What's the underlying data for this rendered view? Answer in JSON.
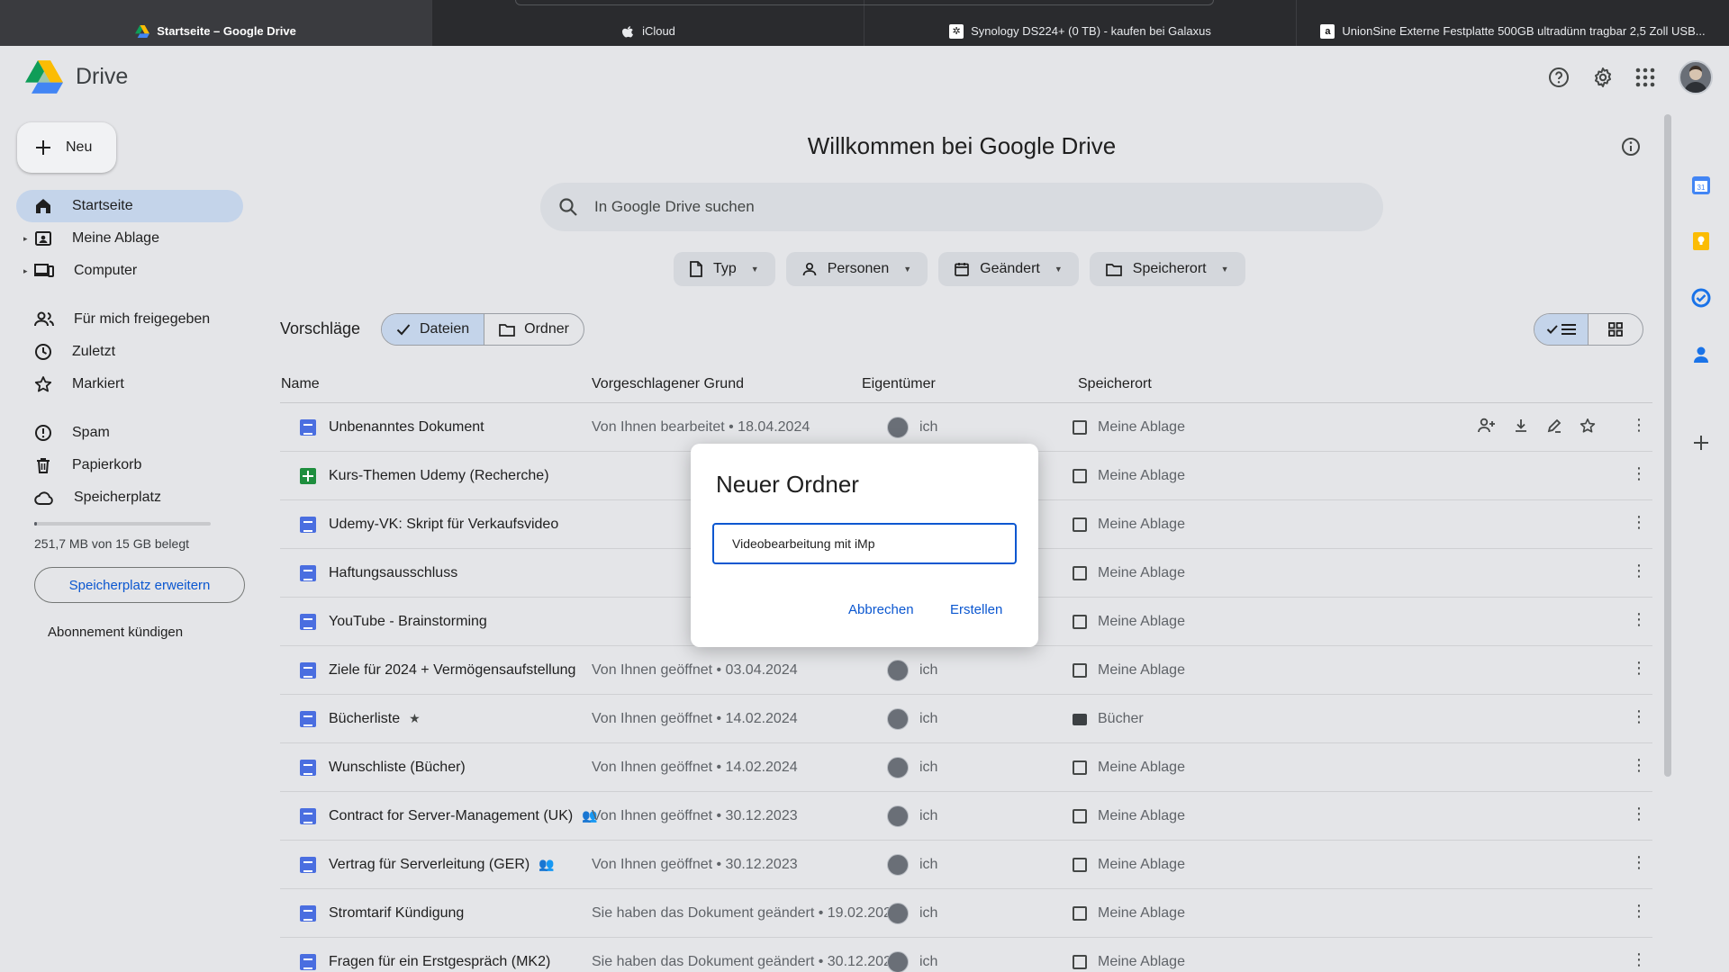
{
  "browser": {
    "tabs": [
      {
        "title": "Startseite – Google Drive",
        "active": true,
        "icon": "drive-icon"
      },
      {
        "title": "iCloud",
        "active": false,
        "icon": "apple-icon"
      },
      {
        "title": "Synology DS224+ (0 TB) - kaufen bei Galaxus",
        "active": false,
        "icon": "galaxus-icon"
      },
      {
        "title": "UnionSine Externe Festplatte 500GB ultradünn tragbar 2,5 Zoll USB...",
        "active": false,
        "icon": "amazon-icon"
      }
    ]
  },
  "app": {
    "name": "Drive"
  },
  "sidebar": {
    "new_label": "Neu",
    "items": [
      {
        "label": "Startseite",
        "icon": "home-icon",
        "active": true
      },
      {
        "label": "Meine Ablage",
        "icon": "drive-folder-icon",
        "active": false
      },
      {
        "label": "Computer",
        "icon": "computer-icon",
        "active": false
      },
      {
        "label": "Für mich freigegeben",
        "icon": "people-icon",
        "active": false
      },
      {
        "label": "Zuletzt",
        "icon": "clock-icon",
        "active": false
      },
      {
        "label": "Markiert",
        "icon": "star-icon",
        "active": false
      },
      {
        "label": "Spam",
        "icon": "spam-icon",
        "active": false
      },
      {
        "label": "Papierkorb",
        "icon": "trash-icon",
        "active": false
      },
      {
        "label": "Speicherplatz",
        "icon": "cloud-icon",
        "active": false
      }
    ],
    "storage_text": "251,7 MB von 15 GB belegt",
    "storage_fraction": 0.017,
    "storage_button": "Speicherplatz erweitern",
    "cancel_subscription": "Abonnement kündigen"
  },
  "main": {
    "welcome": "Willkommen bei Google Drive",
    "search_placeholder": "In Google Drive suchen",
    "filters": [
      "Typ",
      "Personen",
      "Geändert",
      "Speicherort"
    ],
    "suggestions_title": "Vorschläge",
    "segments": [
      "Dateien",
      "Ordner"
    ],
    "columns": [
      "Name",
      "Vorgeschlagener Grund",
      "Eigentümer",
      "Speicherort"
    ],
    "rows": [
      {
        "name": "Unbenanntes Dokument",
        "type": "doc",
        "reason": "Von Ihnen bearbeitet • 18.04.2024",
        "owner": "ich",
        "location": "Meine Ablage",
        "loc_type": "drive"
      },
      {
        "name": "Kurs-Themen Udemy (Recherche)",
        "type": "sheet",
        "reason": "",
        "owner": "ich",
        "location": "Meine Ablage",
        "loc_type": "drive"
      },
      {
        "name": "Udemy-VK: Skript für Verkaufsvideo",
        "type": "doc",
        "reason": "",
        "owner": "ich",
        "location": "Meine Ablage",
        "loc_type": "drive"
      },
      {
        "name": "Haftungsausschluss",
        "type": "doc",
        "reason": "",
        "owner": "ich",
        "location": "Meine Ablage",
        "loc_type": "drive"
      },
      {
        "name": "YouTube - Brainstorming",
        "type": "doc",
        "reason": "",
        "owner": "ich",
        "location": "Meine Ablage",
        "loc_type": "drive"
      },
      {
        "name": "Ziele für 2024 + Vermögensaufstellung",
        "type": "doc",
        "reason": "Von Ihnen geöffnet • 03.04.2024",
        "owner": "ich",
        "location": "Meine Ablage",
        "loc_type": "drive"
      },
      {
        "name": "Bücherliste",
        "type": "doc",
        "tag": "★",
        "reason": "Von Ihnen geöffnet • 14.02.2024",
        "owner": "ich",
        "location": "Bücher",
        "loc_type": "folder"
      },
      {
        "name": "Wunschliste (Bücher)",
        "type": "doc",
        "reason": "Von Ihnen geöffnet • 14.02.2024",
        "owner": "ich",
        "location": "Meine Ablage",
        "loc_type": "drive"
      },
      {
        "name": "Contract for Server-Management (UK)",
        "type": "doc",
        "tag": "👥",
        "reason": "Von Ihnen geöffnet • 30.12.2023",
        "owner": "ich",
        "location": "Meine Ablage",
        "loc_type": "drive"
      },
      {
        "name": "Vertrag für Serverleitung (GER)",
        "type": "doc",
        "tag": "👥",
        "reason": "Von Ihnen geöffnet • 30.12.2023",
        "owner": "ich",
        "location": "Meine Ablage",
        "loc_type": "drive"
      },
      {
        "name": "Stromtarif Kündigung",
        "type": "doc",
        "reason": "Sie haben das Dokument geändert • 19.02.2024",
        "owner": "ich",
        "location": "Meine Ablage",
        "loc_type": "drive"
      },
      {
        "name": "Fragen für ein Erstgespräch (MK2)",
        "type": "doc",
        "reason": "Sie haben das Dokument geändert • 30.12.2023",
        "owner": "ich",
        "location": "Meine Ablage",
        "loc_type": "drive"
      }
    ]
  },
  "dialog": {
    "title": "Neuer Ordner",
    "input_value": "Videobearbeitung mit iMp",
    "cancel": "Abbrechen",
    "create": "Erstellen"
  },
  "colors": {
    "accent": "#0b57d0",
    "active_nav": "#c4d4ea",
    "background": "#e4e5e8"
  }
}
